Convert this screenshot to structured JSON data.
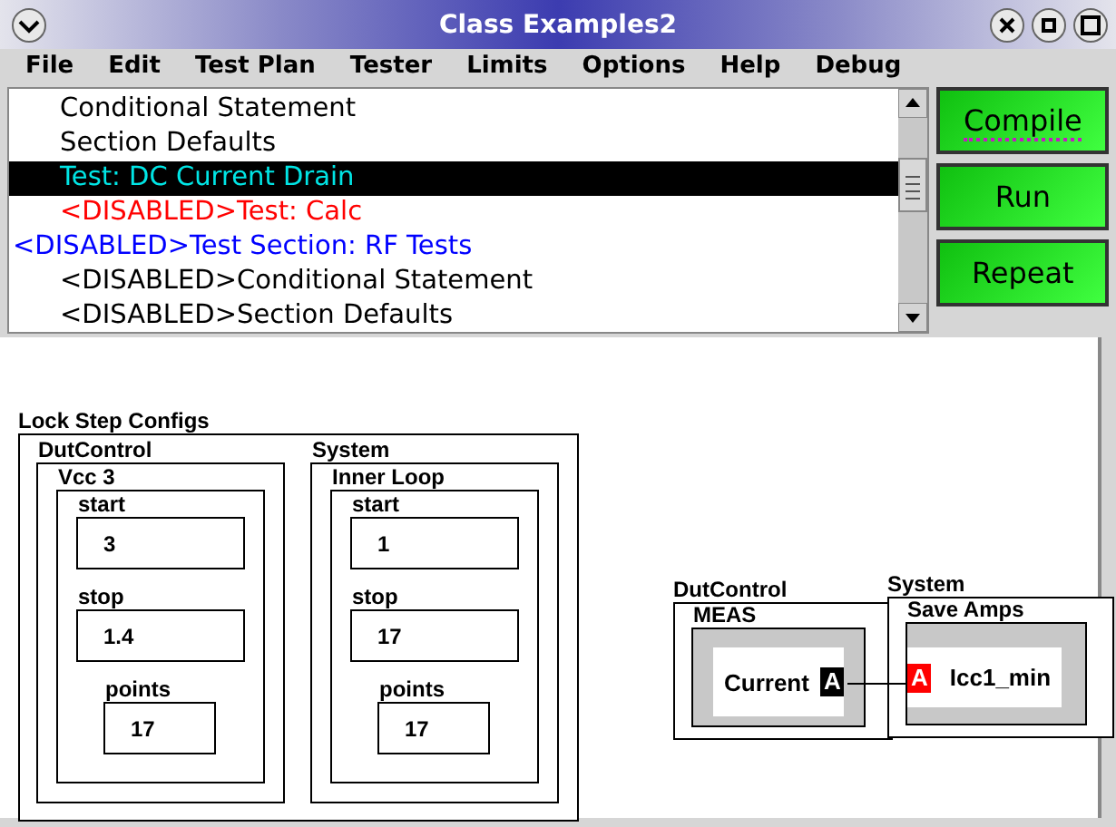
{
  "window": {
    "title": "Class Examples2"
  },
  "menu": [
    "File",
    "Edit",
    "Test Plan",
    "Tester",
    "Limits",
    "Options",
    "Help",
    "Debug"
  ],
  "plan_list": [
    {
      "children": [
        {
          "text": "Conditional Statement",
          "color": "#000000",
          "selected": false
        },
        {
          "text": "Section Defaults",
          "color": "#000000",
          "selected": false
        },
        {
          "text": "Test: DC Current Drain",
          "color": "#00e5e5",
          "selected": true
        },
        {
          "text": "<DISABLED>Test: Calc",
          "color": "#ff0000",
          "selected": false
        }
      ]
    },
    {
      "text": "<DISABLED>Test Section: RF Tests",
      "color": "#0000ff",
      "selected": false,
      "children": [
        {
          "text": "<DISABLED>Conditional Statement",
          "color": "#000000",
          "selected": false
        },
        {
          "text": "<DISABLED>Section Defaults",
          "color": "#000000",
          "selected": false
        }
      ]
    }
  ],
  "buttons": [
    {
      "label": "Compile",
      "focused": true
    },
    {
      "label": "Run",
      "focused": false
    },
    {
      "label": "Repeat",
      "focused": false
    }
  ],
  "lock_step": {
    "title": "Lock Step Configs",
    "groups": [
      {
        "title": "DutControl",
        "loop": "Vcc 3",
        "params": [
          {
            "label": "start",
            "value": "3"
          },
          {
            "label": "stop",
            "value": "1.4"
          },
          {
            "label": "points",
            "value": "17"
          }
        ]
      },
      {
        "title": "System",
        "loop": "Inner Loop",
        "params": [
          {
            "label": "start",
            "value": "1"
          },
          {
            "label": "stop",
            "value": "17"
          },
          {
            "label": "points",
            "value": "17"
          }
        ]
      }
    ]
  },
  "measure": {
    "source": {
      "group": "DutControl",
      "block": "MEAS",
      "value": "Current",
      "port": "A"
    },
    "target": {
      "group": "System",
      "block": "Save Amps",
      "value": "Icc1_min",
      "port": "A"
    }
  }
}
